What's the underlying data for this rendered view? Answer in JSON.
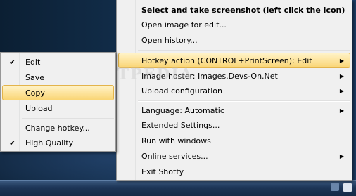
{
  "main_menu": {
    "items": [
      {
        "label": "Select and take screenshot (left click the icon)",
        "bold": true
      },
      {
        "label": "Open image for edit..."
      },
      {
        "label": "Open history..."
      },
      {
        "label": "Hotkey action (CONTROL+PrintScreen): Edit",
        "submenu": true,
        "highlighted": true
      },
      {
        "label": "Image hoster: Images.Devs-On.Net",
        "submenu": true
      },
      {
        "label": "Upload configuration",
        "submenu": true
      },
      {
        "label": "Language: Automatic",
        "submenu": true
      },
      {
        "label": "Extended Settings..."
      },
      {
        "label": "Run with windows"
      },
      {
        "label": "Online services...",
        "submenu": true
      },
      {
        "label": "Exit Shotty"
      }
    ]
  },
  "sub_menu": {
    "items": [
      {
        "label": "Edit",
        "checked": true
      },
      {
        "label": "Save"
      },
      {
        "label": "Copy",
        "highlighted": true
      },
      {
        "label": "Upload"
      },
      {
        "label": "Change hotkey..."
      },
      {
        "label": "High Quality",
        "checked": true
      }
    ]
  },
  "watermark": "SOFTPEDIA",
  "colors": {
    "highlight": "#fde49e",
    "menu_bg": "#f0f0f0"
  }
}
